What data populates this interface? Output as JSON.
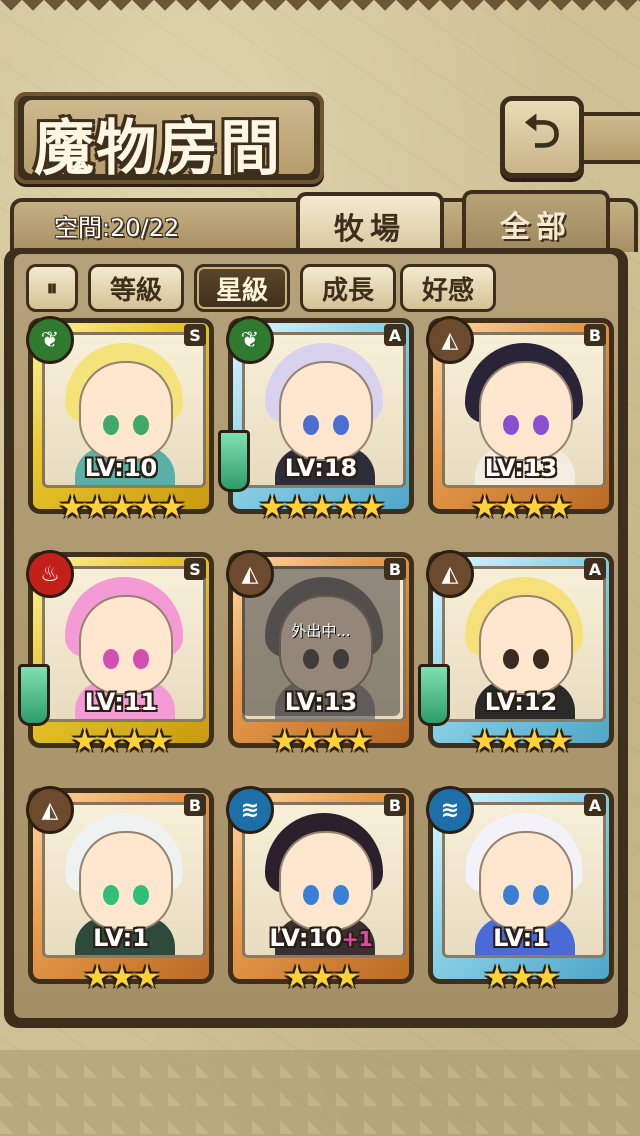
{
  "title": "魔物房間",
  "capacity": "空間:20/22",
  "tabs": {
    "ranch": "牧場",
    "all": "全部"
  },
  "sort": {
    "toggle": "⏸",
    "level": "等級",
    "star": "星級",
    "growth": "成長",
    "affection": "好感",
    "selected": "star"
  },
  "colors": {
    "frame_dark": "#3e2f1c",
    "panel": "#a88f62",
    "star": "#ffd23a"
  },
  "monsters": [
    {
      "rank": "S",
      "element": "wood",
      "level": "LV:10",
      "stars": "★★★★★",
      "hair": "#f4e27a",
      "eye": "#3fa86a",
      "body": "#58b0a6",
      "weapon": false,
      "away": false
    },
    {
      "rank": "A",
      "element": "wood",
      "level": "LV:18",
      "stars": "★★★★★",
      "hair": "#d9d2ee",
      "eye": "#4b6fd0",
      "body": "#2d2d3a",
      "weapon": true,
      "away": false
    },
    {
      "rank": "B",
      "element": "earth",
      "level": "LV:13",
      "stars": "★★★★",
      "hair": "#2a2438",
      "eye": "#8a4fd0",
      "body": "#f3ece0",
      "weapon": false,
      "away": false
    },
    {
      "rank": "S",
      "element": "fire",
      "level": "LV:11",
      "stars": "★★★★",
      "hair": "#f49ad4",
      "eye": "#d14fb0",
      "body": "#f49ad4",
      "weapon": true,
      "away": false
    },
    {
      "rank": "B",
      "element": "earth",
      "level": "LV:13",
      "stars": "★★★★",
      "hair": "#6b6b6b",
      "eye": "#444444",
      "body": "#8a8a8a",
      "weapon": false,
      "away": true,
      "away_text": "外出中..."
    },
    {
      "rank": "A",
      "element": "earth",
      "level": "LV:12",
      "stars": "★★★★",
      "hair": "#f6e07a",
      "eye": "#3a2a20",
      "body": "#2a2a2a",
      "weapon": true,
      "away": false
    },
    {
      "rank": "B",
      "element": "earth",
      "level": "LV:1",
      "stars": "★★★",
      "hair": "#eef3f2",
      "eye": "#2fbf7a",
      "body": "#2e4a3a",
      "weapon": false,
      "away": false
    },
    {
      "rank": "B",
      "element": "water",
      "level": "LV:10",
      "level_bonus": "+1",
      "stars": "★★★",
      "hair": "#2a1f2a",
      "eye": "#3a7fd6",
      "body": "#3a3030",
      "weapon": false,
      "away": false
    },
    {
      "rank": "A",
      "element": "water",
      "level": "LV:1",
      "stars": "★★★",
      "hair": "#f2f2f8",
      "eye": "#3a7fd6",
      "body": "#4a6ad8",
      "weapon": false,
      "away": false
    }
  ]
}
